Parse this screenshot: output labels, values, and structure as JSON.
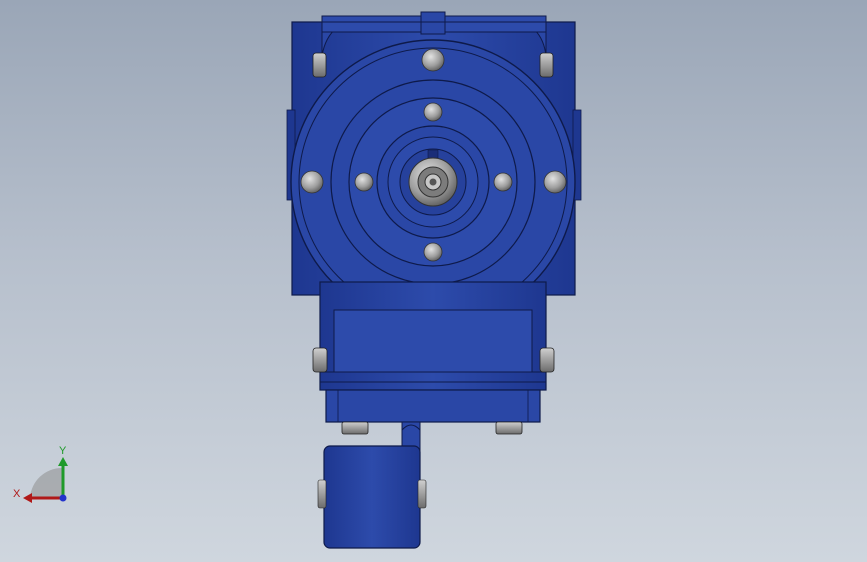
{
  "triad": {
    "x_label": "X",
    "y_label": "Y",
    "colors": {
      "x": "#b01818",
      "y": "#1f9a2a",
      "z": "#2233cc"
    }
  },
  "model": {
    "body_color": "#2a47a6",
    "shade_color": "#1c3487",
    "highlight_color": "#3a5cc4",
    "bolt_color": "#a9a9a9"
  }
}
